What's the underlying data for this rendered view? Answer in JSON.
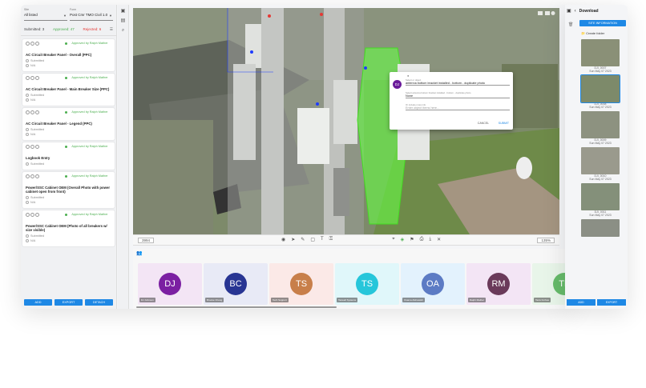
{
  "filters": {
    "first_label": "Site",
    "first_value": "All listed",
    "second_label": "Form",
    "second_value": "Post Cmr TMO Civil 1.0"
  },
  "counts": {
    "submitted": "Submitted: 3",
    "approved": "Approved: 47",
    "rejected": "Rejected: 6"
  },
  "cards": [
    {
      "status": "Approved by Ralph Mather",
      "title": "AC Circuit Breaker Panel - Overall (PPC)",
      "opt1": "Submitted",
      "opt2": "N/A"
    },
    {
      "status": "Approved by Ralph Mather",
      "title": "AC Circuit Breaker Panel - Main Breaker Size (PPC)",
      "opt1": "Submitted",
      "opt2": "N/A"
    },
    {
      "status": "Approved by Ralph Mather",
      "title": "AC Circuit Breaker Panel - Legend (PPC)",
      "opt1": "Submitted",
      "opt2": "N/A"
    },
    {
      "status": "Approved by Ralph Mather",
      "title": "Logbook Entry",
      "opt1": "Submitted",
      "opt2": ""
    },
    {
      "status": "Approved by Ralph Mather",
      "title": "Power/SSC Cabinet OEM (Overall Photo with power cabinet open from front)",
      "opt1": "Submitted",
      "opt2": "N/A"
    },
    {
      "status": "Approved by Ralph Mather",
      "title": "Power/SSC Cabinet OEM (Photo of all breakers w/ size visible)",
      "opt1": "Submitted",
      "opt2": "N/A"
    }
  ],
  "left_buttons": [
    "ADD",
    "EXPORT",
    "DETACH"
  ],
  "toolbar": {
    "page": "3994",
    "zoom": "135%"
  },
  "dialog": {
    "avatar": "DJ",
    "field1_label": "Select or object",
    "field1_value": "antenna bottom bracket installed - bottom - duplicate photo",
    "field2_label": "Select antenna bottom bracket installed - bottom - duplicate photo",
    "field2_value": "None",
    "field3_label": "Or include more info",
    "field3_value": "Enter object items here...",
    "cancel": "CANCEL",
    "submit": "SUBMIT"
  },
  "participants": [
    {
      "initials": "DJ",
      "name": "DJ Johnson",
      "bg": "#f3e5f5",
      "color": "#7b1fa2"
    },
    {
      "initials": "BC",
      "name": "Brooke Chang",
      "bg": "#e8eaf6",
      "color": "#283593"
    },
    {
      "initials": "TS",
      "name": "Tech Support",
      "bg": "#fbe9e7",
      "color": "#c87f4a"
    },
    {
      "initials": "TS",
      "name": "Taswell Systems",
      "bg": "#e0f7fa",
      "color": "#26c6da"
    },
    {
      "initials": "OA",
      "name": "Osama Alshawish",
      "bg": "#e3f2fd",
      "color": "#5c7bc4"
    },
    {
      "initials": "RM",
      "name": "Ralph Mather",
      "bg": "#f3e5f5",
      "color": "#6a3a5a"
    },
    {
      "initials": "TF",
      "name": "Tavis Forbes",
      "bg": "#e8f5e9",
      "color": "#66bb6a"
    }
  ],
  "right_panel": {
    "title": "Download",
    "site_info": "SITE INFORMATION",
    "folder": "Create folder",
    "thumbs": [
      {
        "name": "DJI_0007",
        "date": "Sun May 07 2023"
      },
      {
        "name": "DJI_0008",
        "date": "Sun May 07 2023"
      },
      {
        "name": "DJI_0009",
        "date": "Sun May 07 2023"
      },
      {
        "name": "DJI_0010",
        "date": "Sun May 07 2023"
      },
      {
        "name": "DJI_0011",
        "date": "Sun May 07 2023"
      },
      {
        "name": "DJI_0012",
        "date": "Sun May 07 2023"
      }
    ],
    "buttons": [
      "ADD",
      "EXPORT"
    ]
  },
  "colors": {
    "accent": "#1e88e5",
    "approved": "#4caf50",
    "rejected": "#e53935",
    "selection": "#66ff44"
  }
}
